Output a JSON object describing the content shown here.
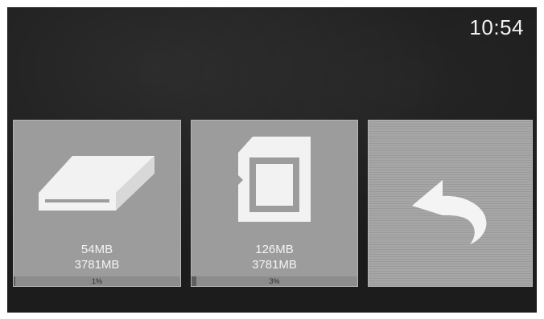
{
  "status_bar": {
    "time": "10:54"
  },
  "tiles": [
    {
      "name": "internal-storage",
      "icon": "hard-drive-icon",
      "used": "54MB",
      "total": "3781MB",
      "percent_label": "1%",
      "percent": 1
    },
    {
      "name": "sd-card-storage",
      "icon": "sd-card-icon",
      "used": "126MB",
      "total": "3781MB",
      "percent_label": "3%",
      "percent": 3
    },
    {
      "name": "back",
      "icon": "back-arrow-icon"
    }
  ],
  "colors": {
    "screen_bg": "#1c1c1c",
    "tile_bg": "#9c9c9c",
    "text": "#f4f4f4",
    "bar_bg": "#8c8c8c"
  }
}
